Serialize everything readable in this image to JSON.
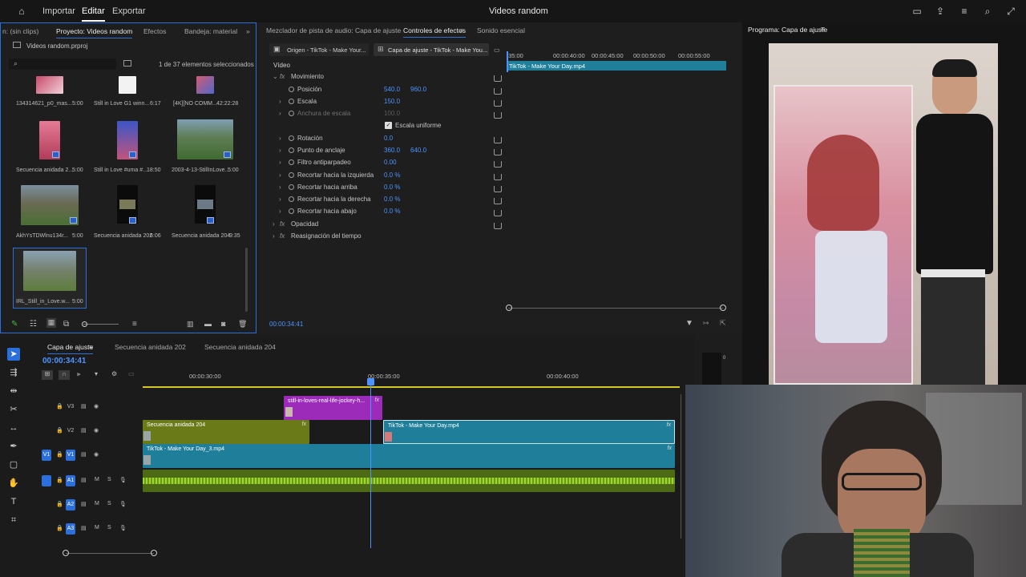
{
  "topbar": {
    "home_icon": "home-icon",
    "menu": [
      "Importar",
      "Editar",
      "Exportar"
    ],
    "active": "Editar",
    "title": "Videos random"
  },
  "project_panel": {
    "tabs": [
      "n: (sin clips)",
      "Proyecto: Videos random",
      "Efectos",
      "Bandeja: material"
    ],
    "active_tab": "Proyecto: Videos random",
    "file": "Videos random.prproj",
    "selection_info": "1 de 37 elementos seleccionados",
    "items": [
      {
        "label": "134314621_p0_mas...",
        "duration": "5:00"
      },
      {
        "label": "Still in Love G1 winn...",
        "duration": "6:17"
      },
      {
        "label": "[4K][NO COMM...",
        "duration": "42:22:28"
      },
      {
        "label": "Secuencia anidada 2...",
        "duration": "5:00"
      },
      {
        "label": "Still in Love #uma #...",
        "duration": "18:50"
      },
      {
        "label": "2003-4-13-StillInLove...",
        "duration": "5:00"
      },
      {
        "label": "AkhYsTDWlnu134r...",
        "duration": "5:00"
      },
      {
        "label": "Secuencia anidada 202",
        "duration": "6:06"
      },
      {
        "label": "Secuencia anidada 204",
        "duration": "9:35"
      },
      {
        "label": "IRL_Still_in_Love.w...",
        "duration": "5:00"
      }
    ]
  },
  "effects_panel": {
    "tabs": [
      "Mezclador de pista de audio: Capa de ajuste",
      "Controles de efectos",
      "Sonido esencial"
    ],
    "active_tab": "Controles de efectos",
    "source_tab": "Origen - TikTok - Make Your...",
    "target_tab": "Capa de ajuste - TikTok - Make You...",
    "section": "Vídeo",
    "rows": [
      {
        "name": "Movimiento",
        "v1": "",
        "v2": ""
      },
      {
        "name": "Posición",
        "v1": "540.0",
        "v2": "960.0"
      },
      {
        "name": "Escala",
        "v1": "150.0",
        "v2": ""
      },
      {
        "name": "Anchura de escala",
        "v1": "100.0",
        "v2": ""
      },
      {
        "name": "Escala uniforme",
        "v1": "",
        "v2": ""
      },
      {
        "name": "Rotación",
        "v1": "0.0",
        "v2": ""
      },
      {
        "name": "Punto de anclaje",
        "v1": "360.0",
        "v2": "640.0"
      },
      {
        "name": "Filtro antiparpadeo",
        "v1": "0.00",
        "v2": ""
      },
      {
        "name": "Recortar hacia la izquierda",
        "v1": "0.0 %",
        "v2": ""
      },
      {
        "name": "Recortar hacia arriba",
        "v1": "0.0 %",
        "v2": ""
      },
      {
        "name": "Recortar hacia la derecha",
        "v1": "0.0 %",
        "v2": ""
      },
      {
        "name": "Recortar hacia abajo",
        "v1": "0.0 %",
        "v2": ""
      },
      {
        "name": "Opacidad",
        "v1": "",
        "v2": ""
      },
      {
        "name": "Reasignación del tiempo",
        "v1": "",
        "v2": ""
      }
    ],
    "mini_ruler": [
      ":35:00",
      "00:00:40:00",
      "00:00:45:00",
      "00:00:50:00",
      "00:00:55:00"
    ],
    "mini_clip": "TikTok - Make Your Day.mp4",
    "timecode": "00:00:34:41"
  },
  "program": {
    "title": "Programa: Capa de ajuste"
  },
  "timeline": {
    "tabs": [
      "Capa de ajuste",
      "Secuencia anidada 202",
      "Secuencia anidada 204"
    ],
    "active_tab": "Capa de ajuste",
    "timecode": "00:00:34:41",
    "ruler": [
      "00:00:30:00",
      "00:00:35:00",
      "00:00:40:00"
    ],
    "tracks": [
      "V3",
      "V2",
      "V1",
      "A1",
      "A2",
      "A3"
    ],
    "clips": {
      "v3": "still-in-loves-real-life-jockey-h...",
      "v2a": "Secuencia anidada 204",
      "v2b": "TikTok - Make Your Day.mp4",
      "v1": "TikTok - Make Your Day_3.mp4"
    },
    "meter_top": "0",
    "meter_labels": [
      "-6",
      "-12"
    ]
  },
  "colors": {
    "accent": "#2a6fdb",
    "clip_purple": "#9b2bb8",
    "clip_olive": "#6b7a18",
    "clip_teal": "#1f7f9a",
    "audio_green": "#4d6a14"
  }
}
